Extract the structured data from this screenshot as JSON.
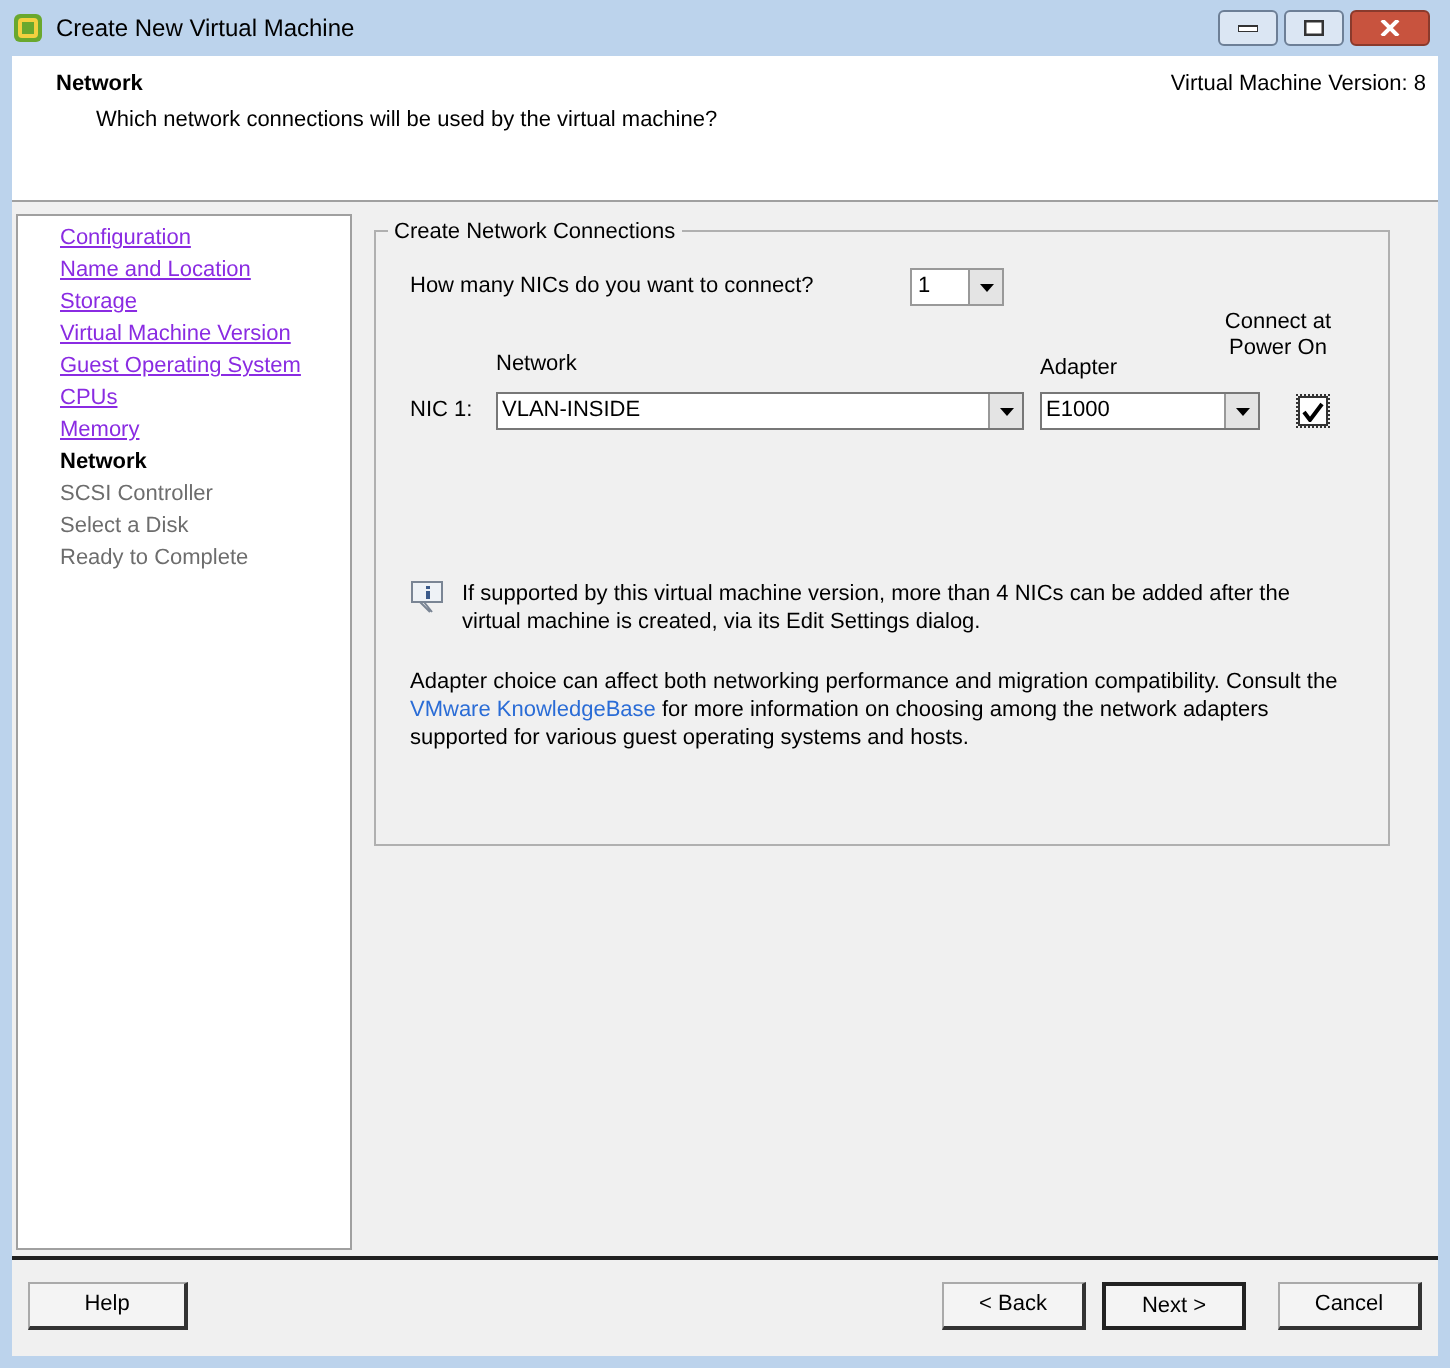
{
  "window": {
    "title": "Create New Virtual Machine"
  },
  "header": {
    "title": "Network",
    "subtitle": "Which network connections will be used by the virtual machine?",
    "version": "Virtual Machine Version: 8"
  },
  "steps": [
    {
      "label": "Configuration",
      "kind": "visited"
    },
    {
      "label": "Name and Location",
      "kind": "visited"
    },
    {
      "label": "Storage",
      "kind": "visited"
    },
    {
      "label": "Virtual Machine Version",
      "kind": "visited"
    },
    {
      "label": "Guest Operating System",
      "kind": "visited"
    },
    {
      "label": "CPUs",
      "kind": "visited"
    },
    {
      "label": "Memory",
      "kind": "visited"
    },
    {
      "label": "Network",
      "kind": "current"
    },
    {
      "label": "SCSI Controller",
      "kind": "pending"
    },
    {
      "label": "Select a Disk",
      "kind": "pending"
    },
    {
      "label": "Ready to Complete",
      "kind": "pending"
    }
  ],
  "group": {
    "title": "Create Network Connections",
    "nic_count_label": "How many NICs do you want to connect?",
    "nic_count": "1",
    "columns": {
      "network": "Network",
      "adapter": "Adapter",
      "connect": "Connect at Power On"
    },
    "nics": [
      {
        "label": "NIC 1:",
        "network": "VLAN-INSIDE",
        "adapter": "E1000",
        "checked": true
      }
    ],
    "info": "If supported by this virtual machine version, more than 4 NICs can be added after the virtual machine is created, via its Edit Settings dialog.",
    "note_before": "Adapter choice can affect both networking performance and migration compatibility. Consult the",
    "note_link": "VMware KnowledgeBase",
    "note_after": "for more information on choosing among the network adapters supported for various guest operating systems and hosts."
  },
  "buttons": {
    "help": "Help",
    "back": "< Back",
    "next": "Next >",
    "cancel": "Cancel"
  }
}
